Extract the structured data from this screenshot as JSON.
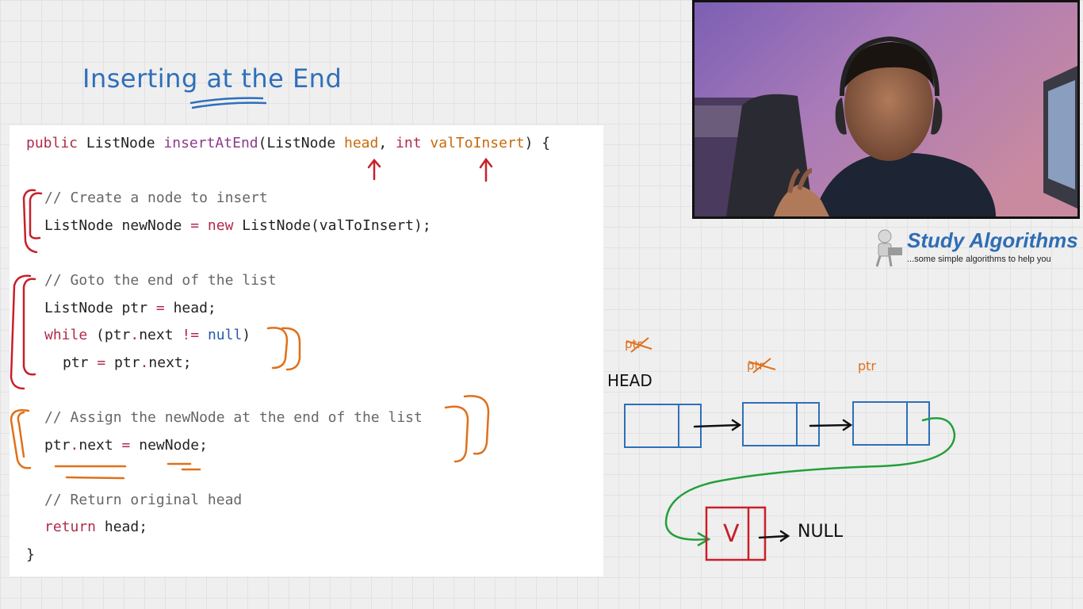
{
  "title": "Inserting at the End",
  "code": {
    "line1": {
      "public_kw": "public",
      "type": " ListNode ",
      "method": "insertAtEnd",
      "open": "(ListNode ",
      "head": "head",
      "comma": ", ",
      "int_kw": "int",
      "space": " ",
      "val": "valToInsert",
      "close": ") {"
    },
    "line2": "// Create a node to insert",
    "line3": {
      "a": "ListNode newNode ",
      "eq": "=",
      "sp": " ",
      "new_kw": "new",
      "b": " ListNode(valToInsert);"
    },
    "line4": "// Goto the end of the list",
    "line5": {
      "a": "ListNode ptr ",
      "eq": "=",
      "b": " head;"
    },
    "line6": {
      "while_kw": "while",
      "a": " (ptr",
      "dot": ".",
      "b": "next ",
      "neq": "!=",
      "sp": " ",
      "null_kw": "null",
      "c": ")"
    },
    "line7": {
      "a": "ptr ",
      "eq": "=",
      "b": " ptr",
      "dot": ".",
      "c": "next;"
    },
    "line8": "// Assign the newNode at the end of the list",
    "line9": {
      "a": "ptr",
      "dot": ".",
      "b": "next ",
      "eq": "=",
      "c": " newNode;"
    },
    "line10": "// Return original head",
    "line11": {
      "return_kw": "return",
      "a": " head;"
    },
    "line12": "}"
  },
  "logo": {
    "name": "Study Algorithms",
    "tagline": "...some simple algorithms to help you"
  },
  "diagram": {
    "head_label": "HEAD",
    "ptr_label_1": "ptr",
    "ptr_label_2": "ptr",
    "ptr_label_3": "ptr",
    "new_node_value": "V",
    "null_label": "NULL"
  },
  "colors": {
    "title": "#2f6fba",
    "annotation_red": "#c8202a",
    "annotation_orange": "#e0701a",
    "node_blue": "#2f6fba",
    "link_green": "#22a03a"
  }
}
